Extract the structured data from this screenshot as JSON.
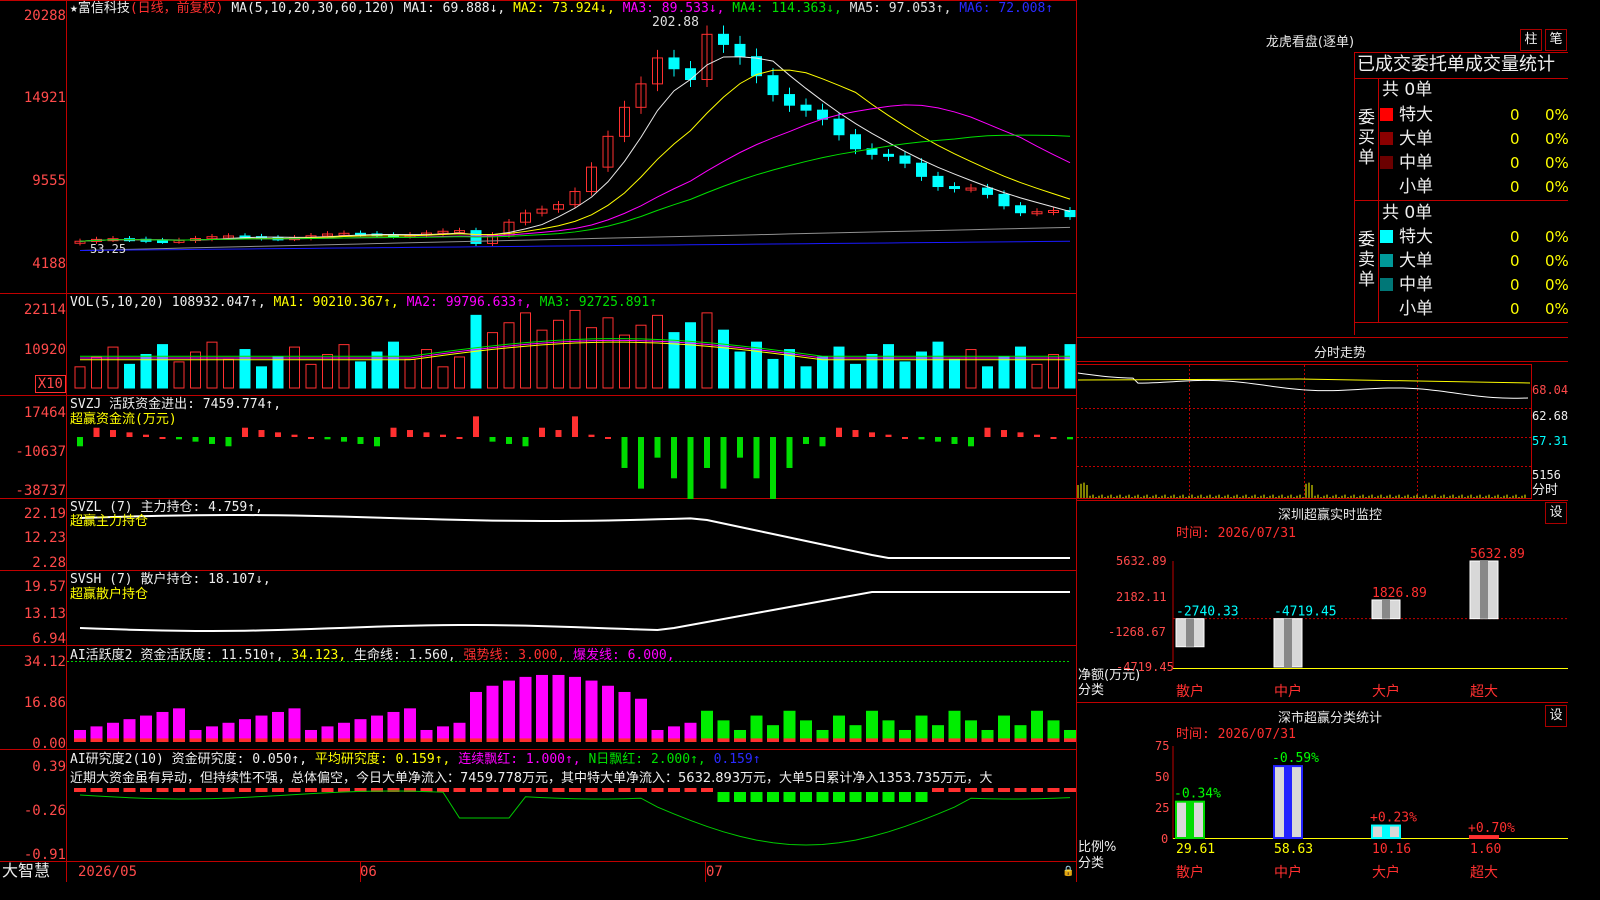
{
  "stock": {
    "title": "★富信科技",
    "period": "(日线，前复权)",
    "ma_line": "MA(5,10,20,30,60,120)",
    "ma1": "MA1: 69.888↓,",
    "ma2": "MA2: 73.924↓,",
    "ma3": "MA3: 89.533↓,",
    "ma4": "MA4: 114.363↓,",
    "ma5": "MA5: 97.053↑,",
    "ma6": "MA6: 72.008↑",
    "high_marker": "202.88",
    "low_marker": "53.25",
    "y_ticks": [
      "20288",
      "14921",
      "9555",
      "4188"
    ],
    "colors": {
      "up": "#ff3030",
      "down": "#00ffff",
      "ma1": "#e8e8e8",
      "ma2": "#ffff00",
      "ma3": "#ff00ff",
      "ma4": "#00e000",
      "ma5": "#909090",
      "ma6": "#1a1aff"
    }
  },
  "vol": {
    "label": "VOL(5,10,20)",
    "val": "108932.047↑,",
    "ma1": "MA1: 90210.367↑,",
    "ma2": "MA2: 99796.633↑,",
    "ma3": "MA3: 92725.891↑",
    "y_ticks": [
      "22114",
      "10920",
      "X10"
    ]
  },
  "svzj": {
    "label": "SVZJ",
    "text": "活跃资金进出: 7459.774↑,",
    "sub": "超赢资金流(万元)",
    "y_ticks": [
      "17464",
      "-10637",
      "-38737"
    ]
  },
  "svzl": {
    "label": "SVZL (7)",
    "text": "主力持仓: 4.759↑,",
    "sub": "超赢主力持仓",
    "y_ticks": [
      "22.19",
      "12.23",
      "2.28"
    ]
  },
  "svsh": {
    "label": "SVSH (7)",
    "text": "散户持仓: 18.107↓,",
    "sub": "超赢散户持仓",
    "y_ticks": [
      "19.57",
      "13.13",
      "6.94"
    ]
  },
  "ai_active": {
    "label": "AI活跃度2",
    "text1": "资金活跃度: 11.510↑,",
    "text2": "34.123,",
    "text3": "生命线: 1.560,",
    "text4": "强势线: 3.000,",
    "text5": "爆发线: 6.000,",
    "y_ticks": [
      "34.12",
      "16.86",
      "0.00"
    ]
  },
  "ai_research": {
    "label": "AI研究度2(10)",
    "text1": "资金研究度: 0.050↑,",
    "text2": "平均研究度: 0.159↑,",
    "text3": "连续飘红: 1.000↑,",
    "text4": "N日飘红: 2.000↑,",
    "text5": "0.159↑",
    "comment": "近期大资金虽有异动，但持续性不强，总体偏空，今日大单净流入：7459.778万元，其中特大单净流入：5632.893万元，大单5日累计净入1353.735万元，大",
    "y_ticks": [
      "0.39",
      "-0.26",
      "-0.91"
    ]
  },
  "xaxis": {
    "brand": "大智慧",
    "labels": [
      "2026/05",
      "06",
      "07"
    ]
  },
  "lhb": {
    "title": "龙虎看盘(逐单)",
    "btn1": "柱",
    "btn2": "笔",
    "header": "已成交委托单成交量统计",
    "buy_label": "委买单",
    "sell_label": "委卖单",
    "buy_total": "共 0单",
    "sell_total": "共 0单",
    "buy_rows": [
      {
        "name": "特大",
        "color": "#ff0000",
        "v1": "0",
        "v2": "0%"
      },
      {
        "name": "大单",
        "color": "#8b0000",
        "v1": "0",
        "v2": "0%"
      },
      {
        "name": "中单",
        "color": "#6b0000",
        "v1": "0",
        "v2": "0%"
      },
      {
        "name": "小单",
        "color": "",
        "v1": "0",
        "v2": "0%"
      }
    ],
    "sell_rows": [
      {
        "name": "特大",
        "color": "#00ffff",
        "v1": "0",
        "v2": "0%"
      },
      {
        "name": "大单",
        "color": "#009999",
        "v1": "0",
        "v2": "0%"
      },
      {
        "name": "中单",
        "color": "#007777",
        "v1": "0",
        "v2": "0%"
      },
      {
        "name": "小单",
        "color": "",
        "v1": "0",
        "v2": "0%"
      }
    ]
  },
  "intraday": {
    "title": "分时走势",
    "y_ticks": [
      "68.04",
      "62.68",
      "57.31",
      "5156"
    ],
    "unit": "分时"
  },
  "sz_monitor": {
    "title": "深圳超赢实时监控",
    "btn": "设",
    "time": "时间: 2026/07/31",
    "y_ticks": [
      "5632.89",
      "2182.11",
      "-1268.67",
      "-4719.45"
    ],
    "ylabel": "净额(万元)",
    "xlabel": "分类",
    "categories": [
      "散户",
      "中户",
      "大户",
      "超大"
    ],
    "values": [
      -2740.33,
      -4719.45,
      1826.89,
      5632.89
    ],
    "value_labels": [
      "-2740.33",
      "-4719.45",
      "1826.89",
      "5632.89"
    ]
  },
  "sz_class": {
    "title": "深市超赢分类统计",
    "btn": "设",
    "time": "时间: 2026/07/31",
    "y_ticks": [
      "75",
      "50",
      "25",
      "0"
    ],
    "ylabel": "比例%",
    "xlabel": "分类",
    "categories": [
      "散户",
      "中户",
      "大户",
      "超大"
    ],
    "values": [
      29.61,
      58.63,
      10.16,
      1.6
    ],
    "value_labels": [
      "29.61",
      "58.63",
      "10.16",
      "1.60"
    ],
    "change_labels": [
      "-0.34%",
      "-0.59%",
      "+0.23%",
      "+0.70%"
    ]
  }
}
